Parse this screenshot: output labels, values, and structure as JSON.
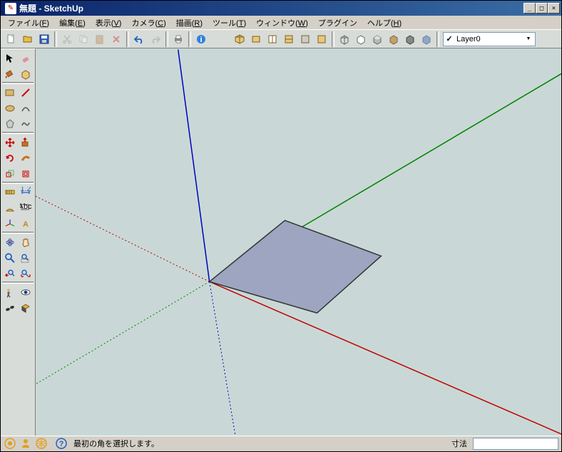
{
  "window": {
    "title": "無題 - SketchUp"
  },
  "menus": {
    "file": {
      "label": "ファイル",
      "key": "F"
    },
    "edit": {
      "label": "編集",
      "key": "E"
    },
    "view": {
      "label": "表示",
      "key": "V"
    },
    "camera": {
      "label": "カメラ",
      "key": "C"
    },
    "draw": {
      "label": "描画",
      "key": "R"
    },
    "tools": {
      "label": "ツール",
      "key": "T"
    },
    "window": {
      "label": "ウィンドウ",
      "key": "W"
    },
    "plugin": {
      "label": "プラグイン"
    },
    "help": {
      "label": "ヘルプ",
      "key": "H"
    }
  },
  "layer": {
    "current": "Layer0",
    "checked": "✓"
  },
  "status": {
    "hint": "最初の角を選択します。",
    "dim_label": "寸法",
    "dim_value": ""
  }
}
